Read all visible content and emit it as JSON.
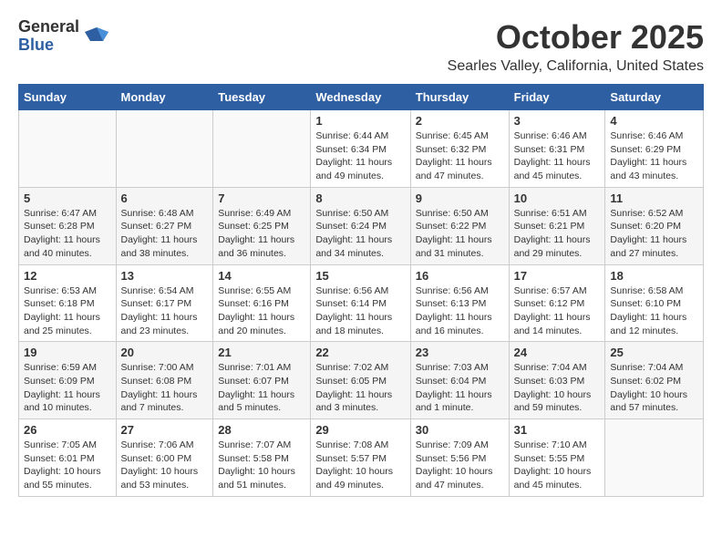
{
  "header": {
    "logo_general": "General",
    "logo_blue": "Blue",
    "month": "October 2025",
    "location": "Searles Valley, California, United States"
  },
  "weekdays": [
    "Sunday",
    "Monday",
    "Tuesday",
    "Wednesday",
    "Thursday",
    "Friday",
    "Saturday"
  ],
  "weeks": [
    [
      {
        "day": "",
        "detail": ""
      },
      {
        "day": "",
        "detail": ""
      },
      {
        "day": "",
        "detail": ""
      },
      {
        "day": "1",
        "detail": "Sunrise: 6:44 AM\nSunset: 6:34 PM\nDaylight: 11 hours and 49 minutes."
      },
      {
        "day": "2",
        "detail": "Sunrise: 6:45 AM\nSunset: 6:32 PM\nDaylight: 11 hours and 47 minutes."
      },
      {
        "day": "3",
        "detail": "Sunrise: 6:46 AM\nSunset: 6:31 PM\nDaylight: 11 hours and 45 minutes."
      },
      {
        "day": "4",
        "detail": "Sunrise: 6:46 AM\nSunset: 6:29 PM\nDaylight: 11 hours and 43 minutes."
      }
    ],
    [
      {
        "day": "5",
        "detail": "Sunrise: 6:47 AM\nSunset: 6:28 PM\nDaylight: 11 hours and 40 minutes."
      },
      {
        "day": "6",
        "detail": "Sunrise: 6:48 AM\nSunset: 6:27 PM\nDaylight: 11 hours and 38 minutes."
      },
      {
        "day": "7",
        "detail": "Sunrise: 6:49 AM\nSunset: 6:25 PM\nDaylight: 11 hours and 36 minutes."
      },
      {
        "day": "8",
        "detail": "Sunrise: 6:50 AM\nSunset: 6:24 PM\nDaylight: 11 hours and 34 minutes."
      },
      {
        "day": "9",
        "detail": "Sunrise: 6:50 AM\nSunset: 6:22 PM\nDaylight: 11 hours and 31 minutes."
      },
      {
        "day": "10",
        "detail": "Sunrise: 6:51 AM\nSunset: 6:21 PM\nDaylight: 11 hours and 29 minutes."
      },
      {
        "day": "11",
        "detail": "Sunrise: 6:52 AM\nSunset: 6:20 PM\nDaylight: 11 hours and 27 minutes."
      }
    ],
    [
      {
        "day": "12",
        "detail": "Sunrise: 6:53 AM\nSunset: 6:18 PM\nDaylight: 11 hours and 25 minutes."
      },
      {
        "day": "13",
        "detail": "Sunrise: 6:54 AM\nSunset: 6:17 PM\nDaylight: 11 hours and 23 minutes."
      },
      {
        "day": "14",
        "detail": "Sunrise: 6:55 AM\nSunset: 6:16 PM\nDaylight: 11 hours and 20 minutes."
      },
      {
        "day": "15",
        "detail": "Sunrise: 6:56 AM\nSunset: 6:14 PM\nDaylight: 11 hours and 18 minutes."
      },
      {
        "day": "16",
        "detail": "Sunrise: 6:56 AM\nSunset: 6:13 PM\nDaylight: 11 hours and 16 minutes."
      },
      {
        "day": "17",
        "detail": "Sunrise: 6:57 AM\nSunset: 6:12 PM\nDaylight: 11 hours and 14 minutes."
      },
      {
        "day": "18",
        "detail": "Sunrise: 6:58 AM\nSunset: 6:10 PM\nDaylight: 11 hours and 12 minutes."
      }
    ],
    [
      {
        "day": "19",
        "detail": "Sunrise: 6:59 AM\nSunset: 6:09 PM\nDaylight: 11 hours and 10 minutes."
      },
      {
        "day": "20",
        "detail": "Sunrise: 7:00 AM\nSunset: 6:08 PM\nDaylight: 11 hours and 7 minutes."
      },
      {
        "day": "21",
        "detail": "Sunrise: 7:01 AM\nSunset: 6:07 PM\nDaylight: 11 hours and 5 minutes."
      },
      {
        "day": "22",
        "detail": "Sunrise: 7:02 AM\nSunset: 6:05 PM\nDaylight: 11 hours and 3 minutes."
      },
      {
        "day": "23",
        "detail": "Sunrise: 7:03 AM\nSunset: 6:04 PM\nDaylight: 11 hours and 1 minute."
      },
      {
        "day": "24",
        "detail": "Sunrise: 7:04 AM\nSunset: 6:03 PM\nDaylight: 10 hours and 59 minutes."
      },
      {
        "day": "25",
        "detail": "Sunrise: 7:04 AM\nSunset: 6:02 PM\nDaylight: 10 hours and 57 minutes."
      }
    ],
    [
      {
        "day": "26",
        "detail": "Sunrise: 7:05 AM\nSunset: 6:01 PM\nDaylight: 10 hours and 55 minutes."
      },
      {
        "day": "27",
        "detail": "Sunrise: 7:06 AM\nSunset: 6:00 PM\nDaylight: 10 hours and 53 minutes."
      },
      {
        "day": "28",
        "detail": "Sunrise: 7:07 AM\nSunset: 5:58 PM\nDaylight: 10 hours and 51 minutes."
      },
      {
        "day": "29",
        "detail": "Sunrise: 7:08 AM\nSunset: 5:57 PM\nDaylight: 10 hours and 49 minutes."
      },
      {
        "day": "30",
        "detail": "Sunrise: 7:09 AM\nSunset: 5:56 PM\nDaylight: 10 hours and 47 minutes."
      },
      {
        "day": "31",
        "detail": "Sunrise: 7:10 AM\nSunset: 5:55 PM\nDaylight: 10 hours and 45 minutes."
      },
      {
        "day": "",
        "detail": ""
      }
    ]
  ]
}
